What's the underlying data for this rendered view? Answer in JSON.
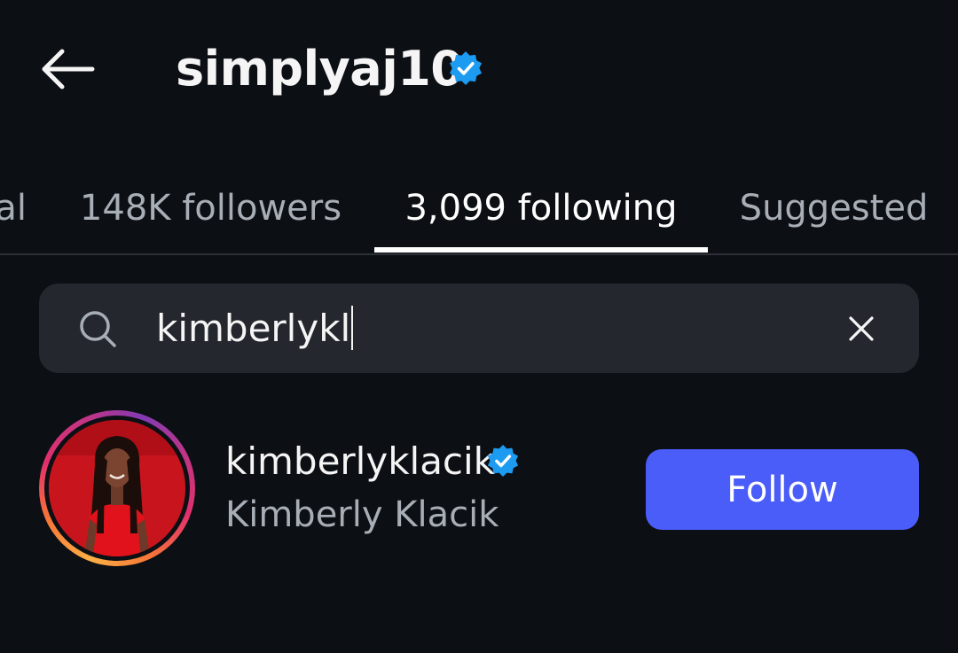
{
  "header": {
    "username": "simplyaj10",
    "verified_icon": "verified-badge-icon",
    "back_icon": "arrow-left-icon"
  },
  "tabs": [
    {
      "label": "al",
      "active": false
    },
    {
      "label": "148K followers",
      "active": false
    },
    {
      "label": "3,099 following",
      "active": true
    },
    {
      "label": "Suggested",
      "active": false
    }
  ],
  "search": {
    "value": "kimberlykl",
    "search_icon": "search-icon",
    "clear_icon": "close-icon"
  },
  "results": [
    {
      "username": "kimberlyklacik",
      "full_name": "Kimberly Klacik",
      "verified": true,
      "follow_label": "Follow"
    }
  ],
  "colors": {
    "background": "#0c0f14",
    "search_bg": "#24282e",
    "verified": "#1d9bf0",
    "follow_button": "#4a5df9",
    "secondary_text": "#a8aeb6"
  }
}
